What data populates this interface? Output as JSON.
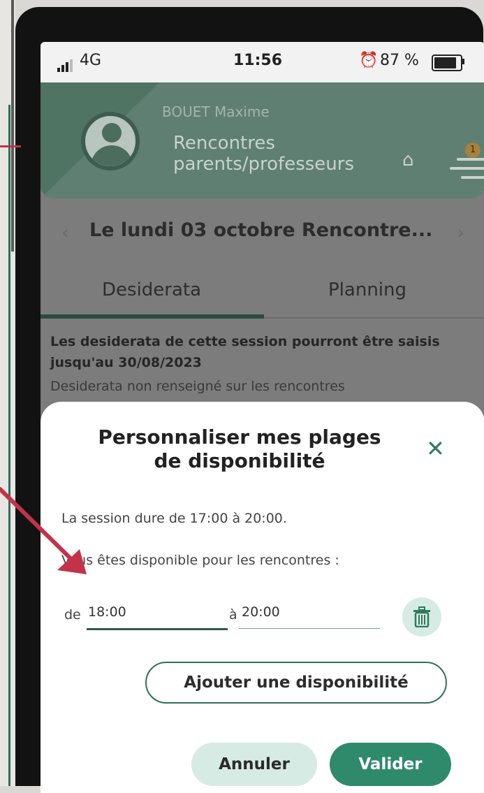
{
  "status_bar": {
    "network": "4G",
    "time": "11:56",
    "battery": "87 %",
    "battery_level": 0.87,
    "icons": [
      "signal-icon",
      "alarm-icon",
      "battery-icon"
    ]
  },
  "header": {
    "user_name": "BOUET Maxime",
    "title_line1": "Rencontres",
    "title_line2": "parents/professeurs",
    "notification_count": "1",
    "icons": [
      "avatar-icon",
      "home-icon",
      "menu-icon"
    ]
  },
  "session": {
    "title": "Le lundi 03 octobre Rencontre...",
    "prev_icon": "chevron-left-icon",
    "next_icon": "chevron-right-icon"
  },
  "tabs": [
    {
      "label": "Desiderata",
      "active": true
    },
    {
      "label": "Planning",
      "active": false
    }
  ],
  "info": {
    "deadline": "Les desiderata de cette session pourront être saisis jusqu'au 30/08/2023",
    "status": "Desiderata non renseigné sur les rencontres"
  },
  "modal": {
    "title": "Personnaliser mes plages de disponibilité",
    "session_duration": "La session dure de 17:00 à 20:00.",
    "available_label": "Vous êtes disponible pour les rencontres :",
    "from_label": "de",
    "from_value": "18:00",
    "to_label": "à",
    "to_value": "20:00",
    "add_button": "Ajouter une disponibilité",
    "cancel_button": "Annuler",
    "validate_button": "Valider"
  },
  "colors": {
    "brand_green": "#2f8a6c",
    "dark_green": "#2c5c4c",
    "light_green": "#d6ebe4",
    "annotation_red": "#c2334a"
  }
}
